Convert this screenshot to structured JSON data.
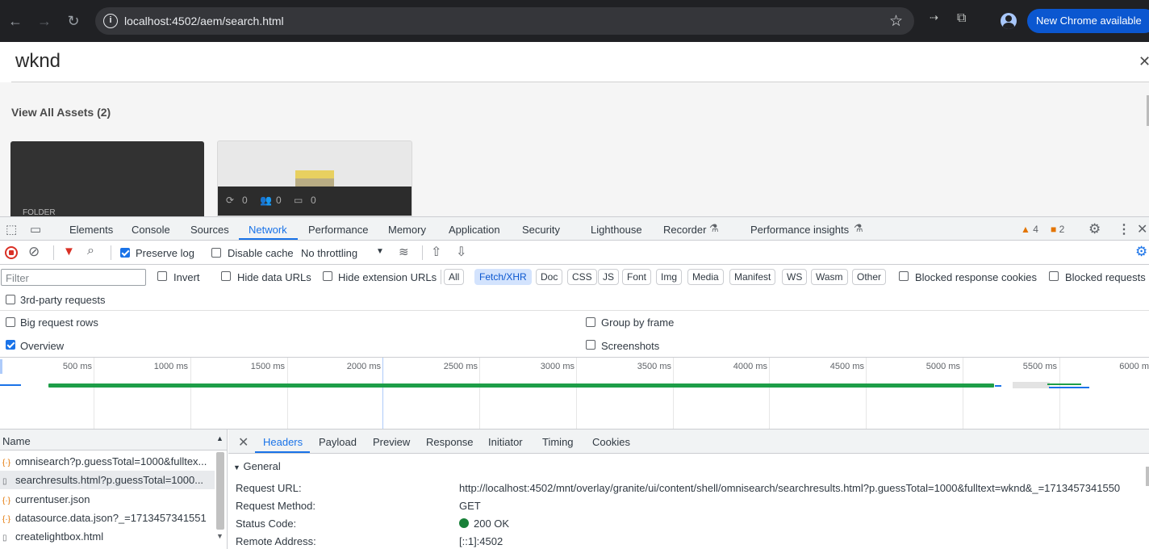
{
  "browser": {
    "url": "localhost:4502/aem/search.html",
    "update_label": "New Chrome available"
  },
  "aem": {
    "search_term": "wknd",
    "view_all_label": "View All Assets (2)",
    "folder_card_label": "FOLDER",
    "asset_meta": [
      "0",
      "0",
      "0"
    ]
  },
  "devtools": {
    "tabs": [
      "Elements",
      "Console",
      "Sources",
      "Network",
      "Performance",
      "Memory",
      "Application",
      "Security",
      "Lighthouse",
      "Recorder",
      "Performance insights"
    ],
    "warnings_count": "4",
    "issues_count": "2",
    "toolbar": {
      "preserve_log": "Preserve log",
      "disable_cache": "Disable cache",
      "throttling": "No throttling"
    },
    "filter": {
      "placeholder": "Filter",
      "invert": "Invert",
      "hide_data_urls": "Hide data URLs",
      "hide_extension_urls": "Hide extension URLs",
      "types": [
        "All",
        "Fetch/XHR",
        "Doc",
        "CSS",
        "JS",
        "Font",
        "Img",
        "Media",
        "Manifest",
        "WS",
        "Wasm",
        "Other"
      ],
      "active_type": "Fetch/XHR",
      "blocked_response_cookies": "Blocked response cookies",
      "blocked_requests": "Blocked requests"
    },
    "options": {
      "third_party": "3rd-party requests",
      "big_rows": "Big request rows",
      "group_by_frame": "Group by frame",
      "overview": "Overview",
      "screenshots": "Screenshots"
    },
    "timeline": {
      "ticks": [
        "500 ms",
        "1000 ms",
        "1500 ms",
        "2000 ms",
        "2500 ms",
        "3000 ms",
        "3500 ms",
        "4000 ms",
        "4500 ms",
        "5000 ms",
        "5500 ms",
        "6000 m"
      ]
    },
    "requests": {
      "header": "Name",
      "rows": [
        {
          "name": "omnisearch?p.guessTotal=1000&fulltex...",
          "kind": "xhr"
        },
        {
          "name": "searchresults.html?p.guessTotal=1000...",
          "kind": "doc"
        },
        {
          "name": "currentuser.json",
          "kind": "xhr"
        },
        {
          "name": "datasource.data.json?_=1713457341551",
          "kind": "xhr"
        },
        {
          "name": "createlightbox.html",
          "kind": "doc"
        }
      ]
    },
    "detail_tabs": [
      "Headers",
      "Payload",
      "Preview",
      "Response",
      "Initiator",
      "Timing",
      "Cookies"
    ],
    "general": {
      "title": "General",
      "request_url_label": "Request URL:",
      "request_url": "http://localhost:4502/mnt/overlay/granite/ui/content/shell/omnisearch/searchresults.html?p.guessTotal=1000&fulltext=wknd&_=1713457341550",
      "method_label": "Request Method:",
      "method": "GET",
      "status_label": "Status Code:",
      "status": "200 OK",
      "remote_label": "Remote Address:",
      "remote": "[::1]:4502"
    }
  }
}
